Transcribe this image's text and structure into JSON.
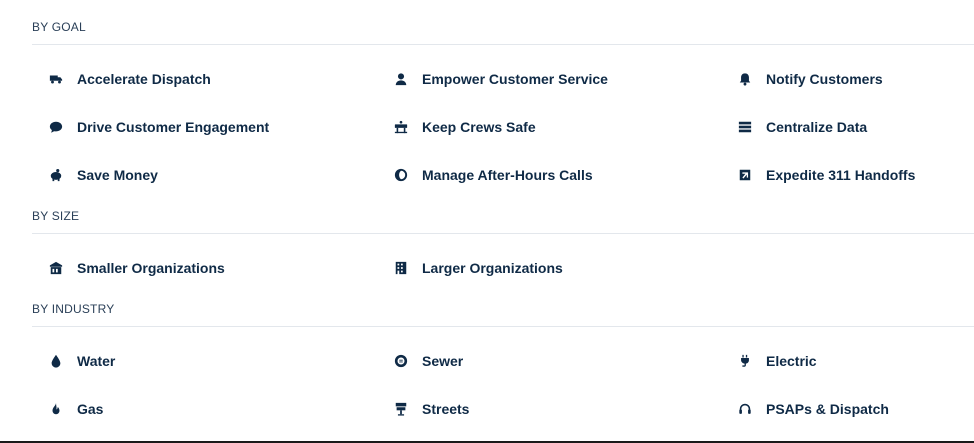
{
  "sections": {
    "goal": {
      "heading": "BY GOAL",
      "items": [
        {
          "label": "Accelerate Dispatch",
          "icon": "truck-icon"
        },
        {
          "label": "Empower Customer Service",
          "icon": "agent-icon"
        },
        {
          "label": "Notify Customers",
          "icon": "bell-icon"
        },
        {
          "label": "Drive Customer Engagement",
          "icon": "chat-bubble-icon"
        },
        {
          "label": "Keep Crews Safe",
          "icon": "barrier-icon"
        },
        {
          "label": "Centralize Data",
          "icon": "list-bars-icon"
        },
        {
          "label": "Save Money",
          "icon": "piggy-bank-icon"
        },
        {
          "label": "Manage After-Hours Calls",
          "icon": "face-icon"
        },
        {
          "label": "Expedite 311 Handoffs",
          "icon": "clipboard-icon"
        }
      ]
    },
    "size": {
      "heading": "BY SIZE",
      "items": [
        {
          "label": "Smaller Organizations",
          "icon": "small-building-icon"
        },
        {
          "label": "Larger Organizations",
          "icon": "large-building-icon"
        }
      ]
    },
    "industry": {
      "heading": "BY INDUSTRY",
      "items": [
        {
          "label": "Water",
          "icon": "water-drop-icon"
        },
        {
          "label": "Sewer",
          "icon": "sewer-icon"
        },
        {
          "label": "Electric",
          "icon": "electric-plug-icon"
        },
        {
          "label": "Gas",
          "icon": "flame-icon"
        },
        {
          "label": "Streets",
          "icon": "street-sign-icon"
        },
        {
          "label": "PSAPs & Dispatch",
          "icon": "headset-icon"
        }
      ]
    }
  },
  "colors": {
    "text": "#0f2a46",
    "heading": "#2a3f57",
    "divider": "#e3e7ec"
  }
}
